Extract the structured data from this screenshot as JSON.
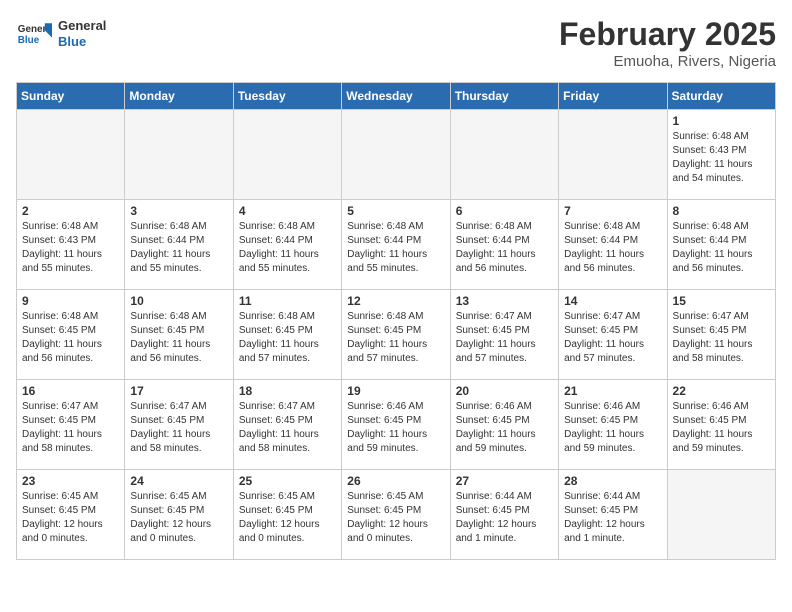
{
  "logo": {
    "text_general": "General",
    "text_blue": "Blue"
  },
  "title": "February 2025",
  "location": "Emuoha, Rivers, Nigeria",
  "days_of_week": [
    "Sunday",
    "Monday",
    "Tuesday",
    "Wednesday",
    "Thursday",
    "Friday",
    "Saturday"
  ],
  "weeks": [
    [
      {
        "day": "",
        "empty": true
      },
      {
        "day": "",
        "empty": true
      },
      {
        "day": "",
        "empty": true
      },
      {
        "day": "",
        "empty": true
      },
      {
        "day": "",
        "empty": true
      },
      {
        "day": "",
        "empty": true
      },
      {
        "day": "1",
        "sunrise": "6:48 AM",
        "sunset": "6:43 PM",
        "daylight": "11 hours and 54 minutes."
      }
    ],
    [
      {
        "day": "2",
        "sunrise": "6:48 AM",
        "sunset": "6:43 PM",
        "daylight": "11 hours and 55 minutes."
      },
      {
        "day": "3",
        "sunrise": "6:48 AM",
        "sunset": "6:44 PM",
        "daylight": "11 hours and 55 minutes."
      },
      {
        "day": "4",
        "sunrise": "6:48 AM",
        "sunset": "6:44 PM",
        "daylight": "11 hours and 55 minutes."
      },
      {
        "day": "5",
        "sunrise": "6:48 AM",
        "sunset": "6:44 PM",
        "daylight": "11 hours and 55 minutes."
      },
      {
        "day": "6",
        "sunrise": "6:48 AM",
        "sunset": "6:44 PM",
        "daylight": "11 hours and 56 minutes."
      },
      {
        "day": "7",
        "sunrise": "6:48 AM",
        "sunset": "6:44 PM",
        "daylight": "11 hours and 56 minutes."
      },
      {
        "day": "8",
        "sunrise": "6:48 AM",
        "sunset": "6:44 PM",
        "daylight": "11 hours and 56 minutes."
      }
    ],
    [
      {
        "day": "9",
        "sunrise": "6:48 AM",
        "sunset": "6:45 PM",
        "daylight": "11 hours and 56 minutes."
      },
      {
        "day": "10",
        "sunrise": "6:48 AM",
        "sunset": "6:45 PM",
        "daylight": "11 hours and 56 minutes."
      },
      {
        "day": "11",
        "sunrise": "6:48 AM",
        "sunset": "6:45 PM",
        "daylight": "11 hours and 57 minutes."
      },
      {
        "day": "12",
        "sunrise": "6:48 AM",
        "sunset": "6:45 PM",
        "daylight": "11 hours and 57 minutes."
      },
      {
        "day": "13",
        "sunrise": "6:47 AM",
        "sunset": "6:45 PM",
        "daylight": "11 hours and 57 minutes."
      },
      {
        "day": "14",
        "sunrise": "6:47 AM",
        "sunset": "6:45 PM",
        "daylight": "11 hours and 57 minutes."
      },
      {
        "day": "15",
        "sunrise": "6:47 AM",
        "sunset": "6:45 PM",
        "daylight": "11 hours and 58 minutes."
      }
    ],
    [
      {
        "day": "16",
        "sunrise": "6:47 AM",
        "sunset": "6:45 PM",
        "daylight": "11 hours and 58 minutes."
      },
      {
        "day": "17",
        "sunrise": "6:47 AM",
        "sunset": "6:45 PM",
        "daylight": "11 hours and 58 minutes."
      },
      {
        "day": "18",
        "sunrise": "6:47 AM",
        "sunset": "6:45 PM",
        "daylight": "11 hours and 58 minutes."
      },
      {
        "day": "19",
        "sunrise": "6:46 AM",
        "sunset": "6:45 PM",
        "daylight": "11 hours and 59 minutes."
      },
      {
        "day": "20",
        "sunrise": "6:46 AM",
        "sunset": "6:45 PM",
        "daylight": "11 hours and 59 minutes."
      },
      {
        "day": "21",
        "sunrise": "6:46 AM",
        "sunset": "6:45 PM",
        "daylight": "11 hours and 59 minutes."
      },
      {
        "day": "22",
        "sunrise": "6:46 AM",
        "sunset": "6:45 PM",
        "daylight": "11 hours and 59 minutes."
      }
    ],
    [
      {
        "day": "23",
        "sunrise": "6:45 AM",
        "sunset": "6:45 PM",
        "daylight": "12 hours and 0 minutes."
      },
      {
        "day": "24",
        "sunrise": "6:45 AM",
        "sunset": "6:45 PM",
        "daylight": "12 hours and 0 minutes."
      },
      {
        "day": "25",
        "sunrise": "6:45 AM",
        "sunset": "6:45 PM",
        "daylight": "12 hours and 0 minutes."
      },
      {
        "day": "26",
        "sunrise": "6:45 AM",
        "sunset": "6:45 PM",
        "daylight": "12 hours and 0 minutes."
      },
      {
        "day": "27",
        "sunrise": "6:44 AM",
        "sunset": "6:45 PM",
        "daylight": "12 hours and 1 minute."
      },
      {
        "day": "28",
        "sunrise": "6:44 AM",
        "sunset": "6:45 PM",
        "daylight": "12 hours and 1 minute."
      },
      {
        "day": "",
        "empty": true
      }
    ]
  ]
}
